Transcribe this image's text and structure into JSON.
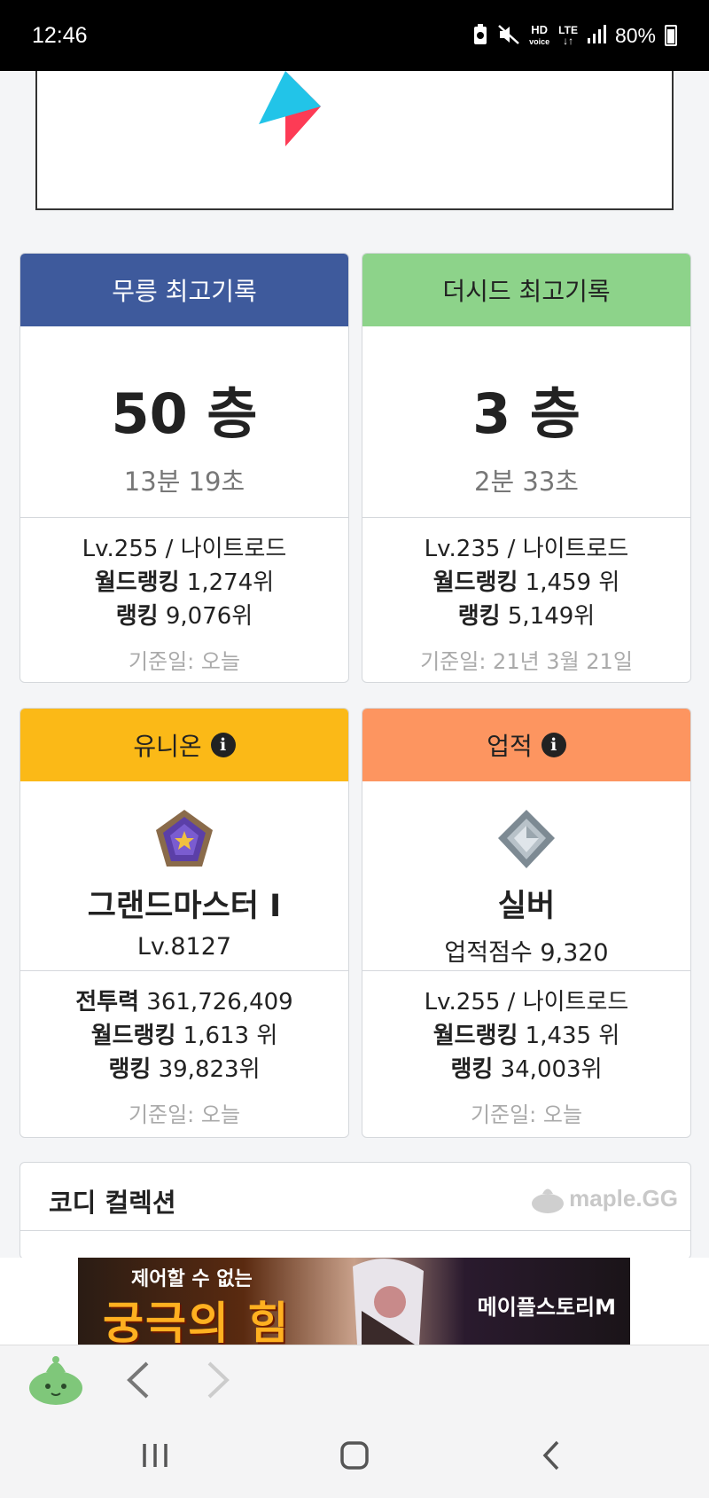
{
  "status_bar": {
    "time": "12:46",
    "battery": "80%",
    "network": "LTE",
    "icons": [
      "recycle-battery-icon",
      "mute-icon",
      "hd-voice-icon",
      "lte-icon",
      "signal-icon",
      "battery-icon"
    ]
  },
  "cards": {
    "mureung": {
      "header": "무릉 최고기록",
      "header_color": "#3e5a9c",
      "floor": "50 층",
      "time": "13분 19초",
      "level_class": "Lv.255 / 나이트로드",
      "world_rank_label": "월드랭킹",
      "world_rank_value": "1,274위",
      "rank_label": "랭킹",
      "rank_value": "9,076위",
      "date": "기준일: 오늘"
    },
    "theseed": {
      "header": "더시드 최고기록",
      "header_color": "#8dd38a",
      "floor": "3 층",
      "time": "2분 33초",
      "level_class": "Lv.235 / 나이트로드",
      "world_rank_label": "월드랭킹",
      "world_rank_value": "1,459 위",
      "rank_label": "랭킹",
      "rank_value": "5,149위",
      "date": "기준일: 21년 3월 21일"
    },
    "union": {
      "header": "유니온",
      "header_color": "#fbb917",
      "grade": "그랜드마스터 I",
      "sub": "Lv.8127",
      "power_label": "전투력",
      "power_value": "361,726,409",
      "world_rank_label": "월드랭킹",
      "world_rank_value": "1,613 위",
      "rank_label": "랭킹",
      "rank_value": "39,823위",
      "date": "기준일: 오늘"
    },
    "achievement": {
      "header": "업적",
      "header_color": "#fd9560",
      "grade": "실버",
      "sub": "업적점수 9,320",
      "level_class": "Lv.255 / 나이트로드",
      "world_rank_label": "월드랭킹",
      "world_rank_value": "1,435 위",
      "rank_label": "랭킹",
      "rank_value": "34,003위",
      "date": "기준일: 오늘"
    }
  },
  "codi": {
    "title": "코디 컬렉션",
    "logo_text": "maple.GG"
  },
  "banner": {
    "line1": "제어할 수 없는",
    "line2": "궁극의 힘",
    "brand": "메이플스토리M"
  }
}
